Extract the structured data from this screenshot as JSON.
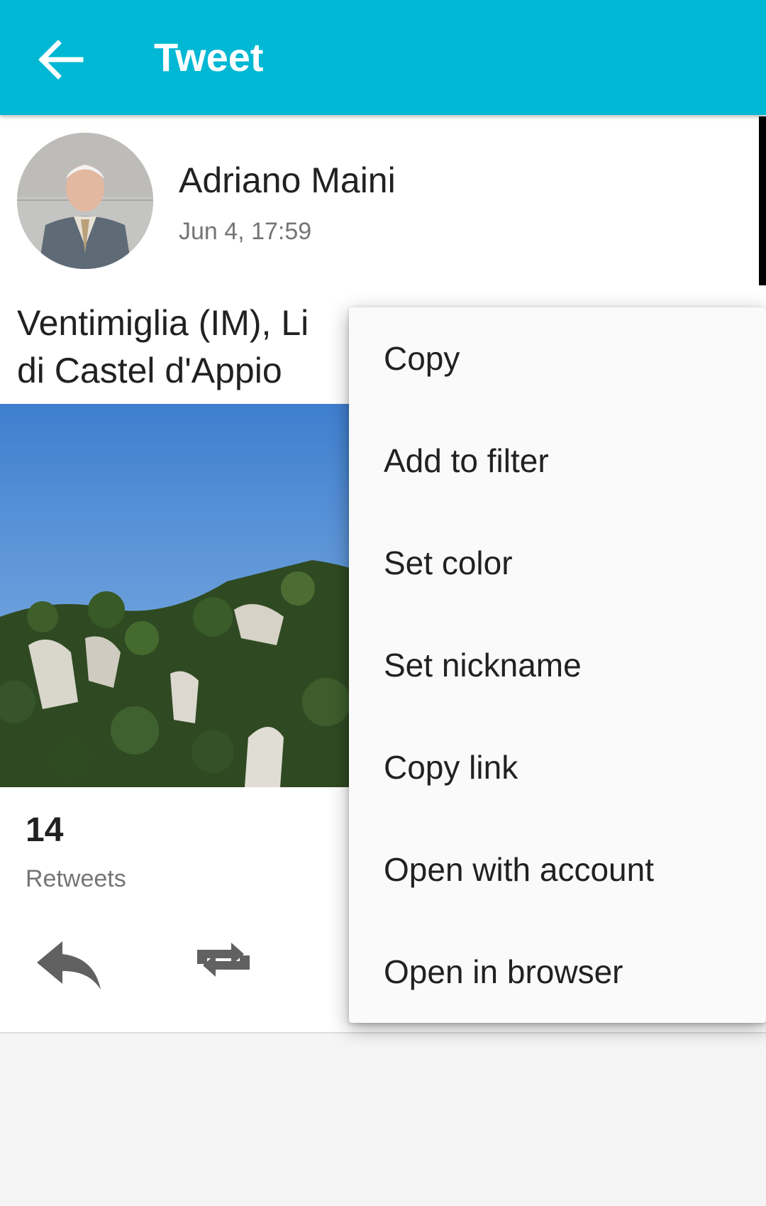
{
  "appbar": {
    "title": "Tweet",
    "back_icon": "arrow-back-icon",
    "background": "#00b8d4"
  },
  "tweet": {
    "author": "Adriano Maini",
    "timestamp": "Jun 4, 17:59",
    "text_line1": "Ventimiglia (IM), Li",
    "text_line2": "di Castel d'Appio",
    "stats": {
      "retweets_count": "14",
      "retweets_label": "Retweets"
    },
    "actions": [
      {
        "icon": "reply-icon"
      },
      {
        "icon": "retweet-icon"
      }
    ]
  },
  "context_menu": {
    "items": [
      "Copy",
      "Add to filter",
      "Set color",
      "Set nickname",
      "Copy link",
      "Open with account",
      "Open in browser"
    ]
  }
}
